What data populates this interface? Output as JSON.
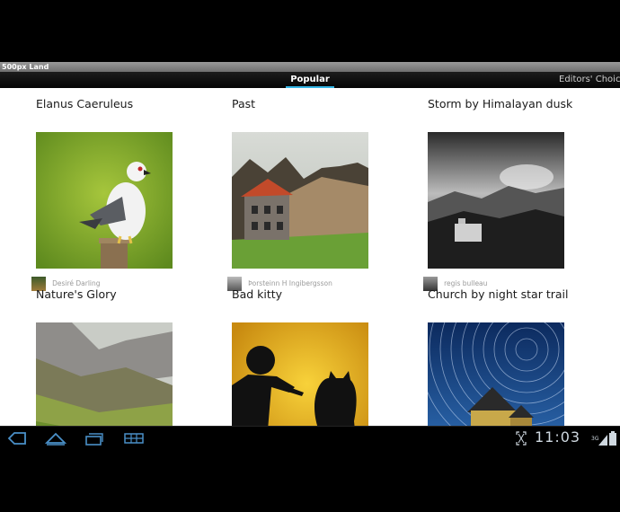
{
  "app": {
    "window_title": "500px Land"
  },
  "tabs": [
    {
      "label": "Popular",
      "selected": true
    },
    {
      "label": "Editors' Choice",
      "selected": false
    }
  ],
  "photos": [
    {
      "title": "Elanus Caeruleus",
      "author": "Desiré Darling"
    },
    {
      "title": "Past",
      "author": "Þorsteinn H Ingibergsson"
    },
    {
      "title": "Storm by Himalayan dusk",
      "author": "regis bulleau"
    },
    {
      "title": "Nature's Glory",
      "author": ""
    },
    {
      "title": "Bad kitty",
      "author": ""
    },
    {
      "title": "Church by night star trail",
      "author": ""
    }
  ],
  "system_bar": {
    "clock": "11:03",
    "network": "3G",
    "icons": [
      "back-icon",
      "home-icon",
      "recent-apps-icon",
      "app-menu-icon",
      "fullscreen-icon",
      "signal-icon",
      "battery-icon"
    ]
  },
  "colors": {
    "tab_indicator": "#33b5e5",
    "system_icons": "#4a90c8"
  }
}
